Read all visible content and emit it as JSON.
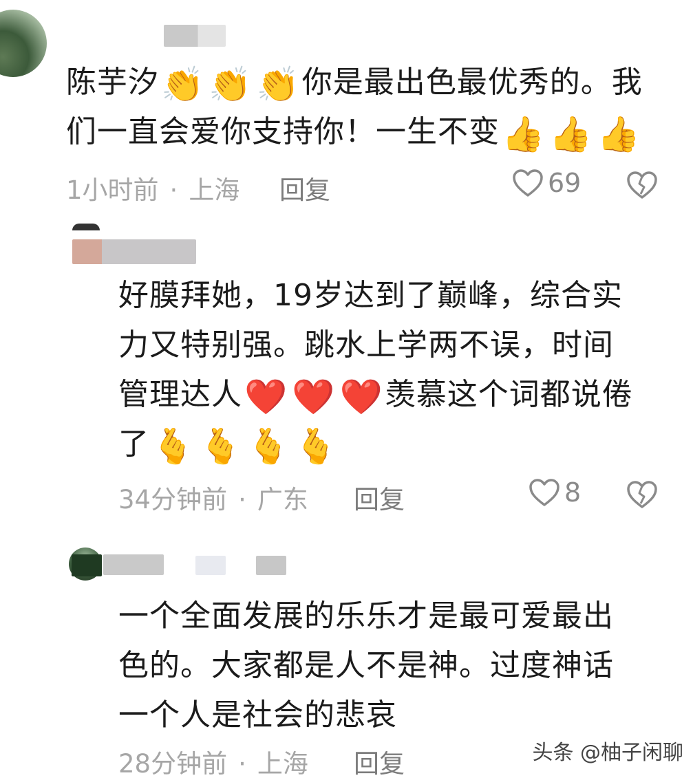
{
  "comments": [
    {
      "text_lines": [
        "陈芋汐",
        "你是最出色最优秀的。我",
        "们一直会爱你支持你！一生不变"
      ],
      "emoji": {
        "clap": "👏",
        "thumbs": "👍"
      },
      "time": "1小时前",
      "location": "上海",
      "reply": "回复",
      "likes": "69"
    },
    {
      "text_lines": [
        "好膜拜她，19岁达到了巅峰，综合实",
        "力又特别强。跳水上学两不误，时间",
        "管理达人",
        "羡慕这个词都说倦",
        "了"
      ],
      "emoji": {
        "heart": "❤️",
        "finger_heart": "🫰"
      },
      "time": "34分钟前",
      "location": "广东",
      "reply": "回复",
      "likes": "8"
    },
    {
      "text_lines": [
        "一个全面发展的乐乐才是最可爱最出",
        "色的。大家都是人不是神。过度神话",
        "一个人是社会的悲哀"
      ],
      "time": "28分钟前",
      "location": "上海",
      "reply": "回复"
    }
  ],
  "separator": "·",
  "watermark": "头条 @柚子闲聊",
  "colors": {
    "text": "#1b1b1b",
    "meta": "#a6a6a6",
    "reply": "#7c7c7c",
    "icon": "#8a8a8a"
  },
  "icons": {
    "like": "heart-outline-icon",
    "dislike": "broken-heart-icon"
  }
}
